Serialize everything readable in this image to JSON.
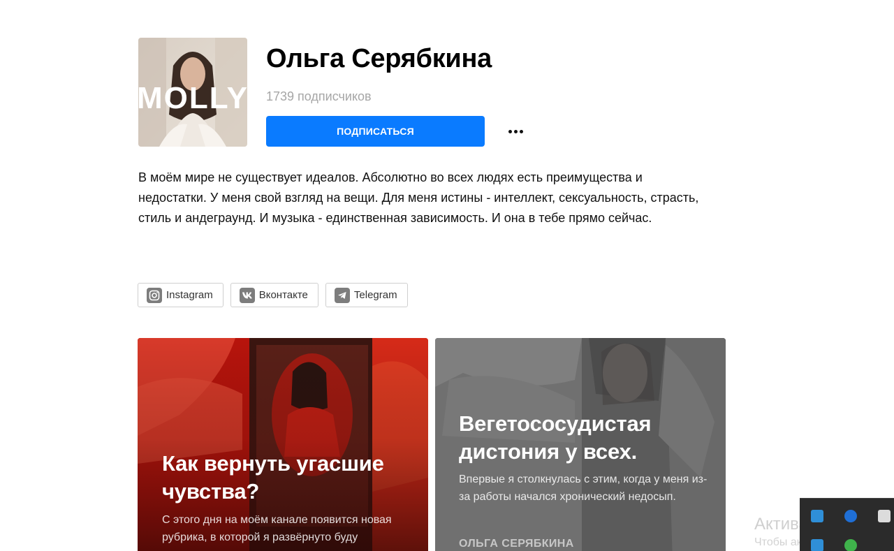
{
  "channel": {
    "avatar_text": "MOLLY",
    "name": "Ольга Серябкина",
    "subscribers": "1739 подписчиков",
    "subscribe_label": "ПОДПИСАТЬСЯ",
    "description": "В моём мире не существует идеалов. Абсолютно во всех людях есть преимущества и недостатки. У меня свой взгляд на вещи. Для меня истины - интеллект, сексуальность, страсть, стиль и андеграунд. И музыка - единственная зависимость. И она в тебе прямо сейчас."
  },
  "socials": [
    {
      "label": "Instagram",
      "icon": "instagram-icon"
    },
    {
      "label": "Вконтакте",
      "icon": "vk-icon"
    },
    {
      "label": "Telegram",
      "icon": "telegram-icon"
    }
  ],
  "cards": [
    {
      "title": "Как вернуть угасшие чувства?",
      "text": "С этого дня на моём канале появится новая рубрика, в которой я развёрнуто буду"
    },
    {
      "title": "Вегетососудистая дистония у всех.",
      "text": "Впервые я столкнулась с этим, когда у меня из-за работы начался хронический недосып.",
      "author": "ОЛЬГА СЕРЯБКИНА"
    }
  ],
  "os_overlay": {
    "activation_title": "Активация Windo",
    "activation_text": "Чтобы активировать Win"
  },
  "colors": {
    "accent": "#0a7bff",
    "card1": "#8c1710",
    "card2": "#6a6a6a"
  }
}
